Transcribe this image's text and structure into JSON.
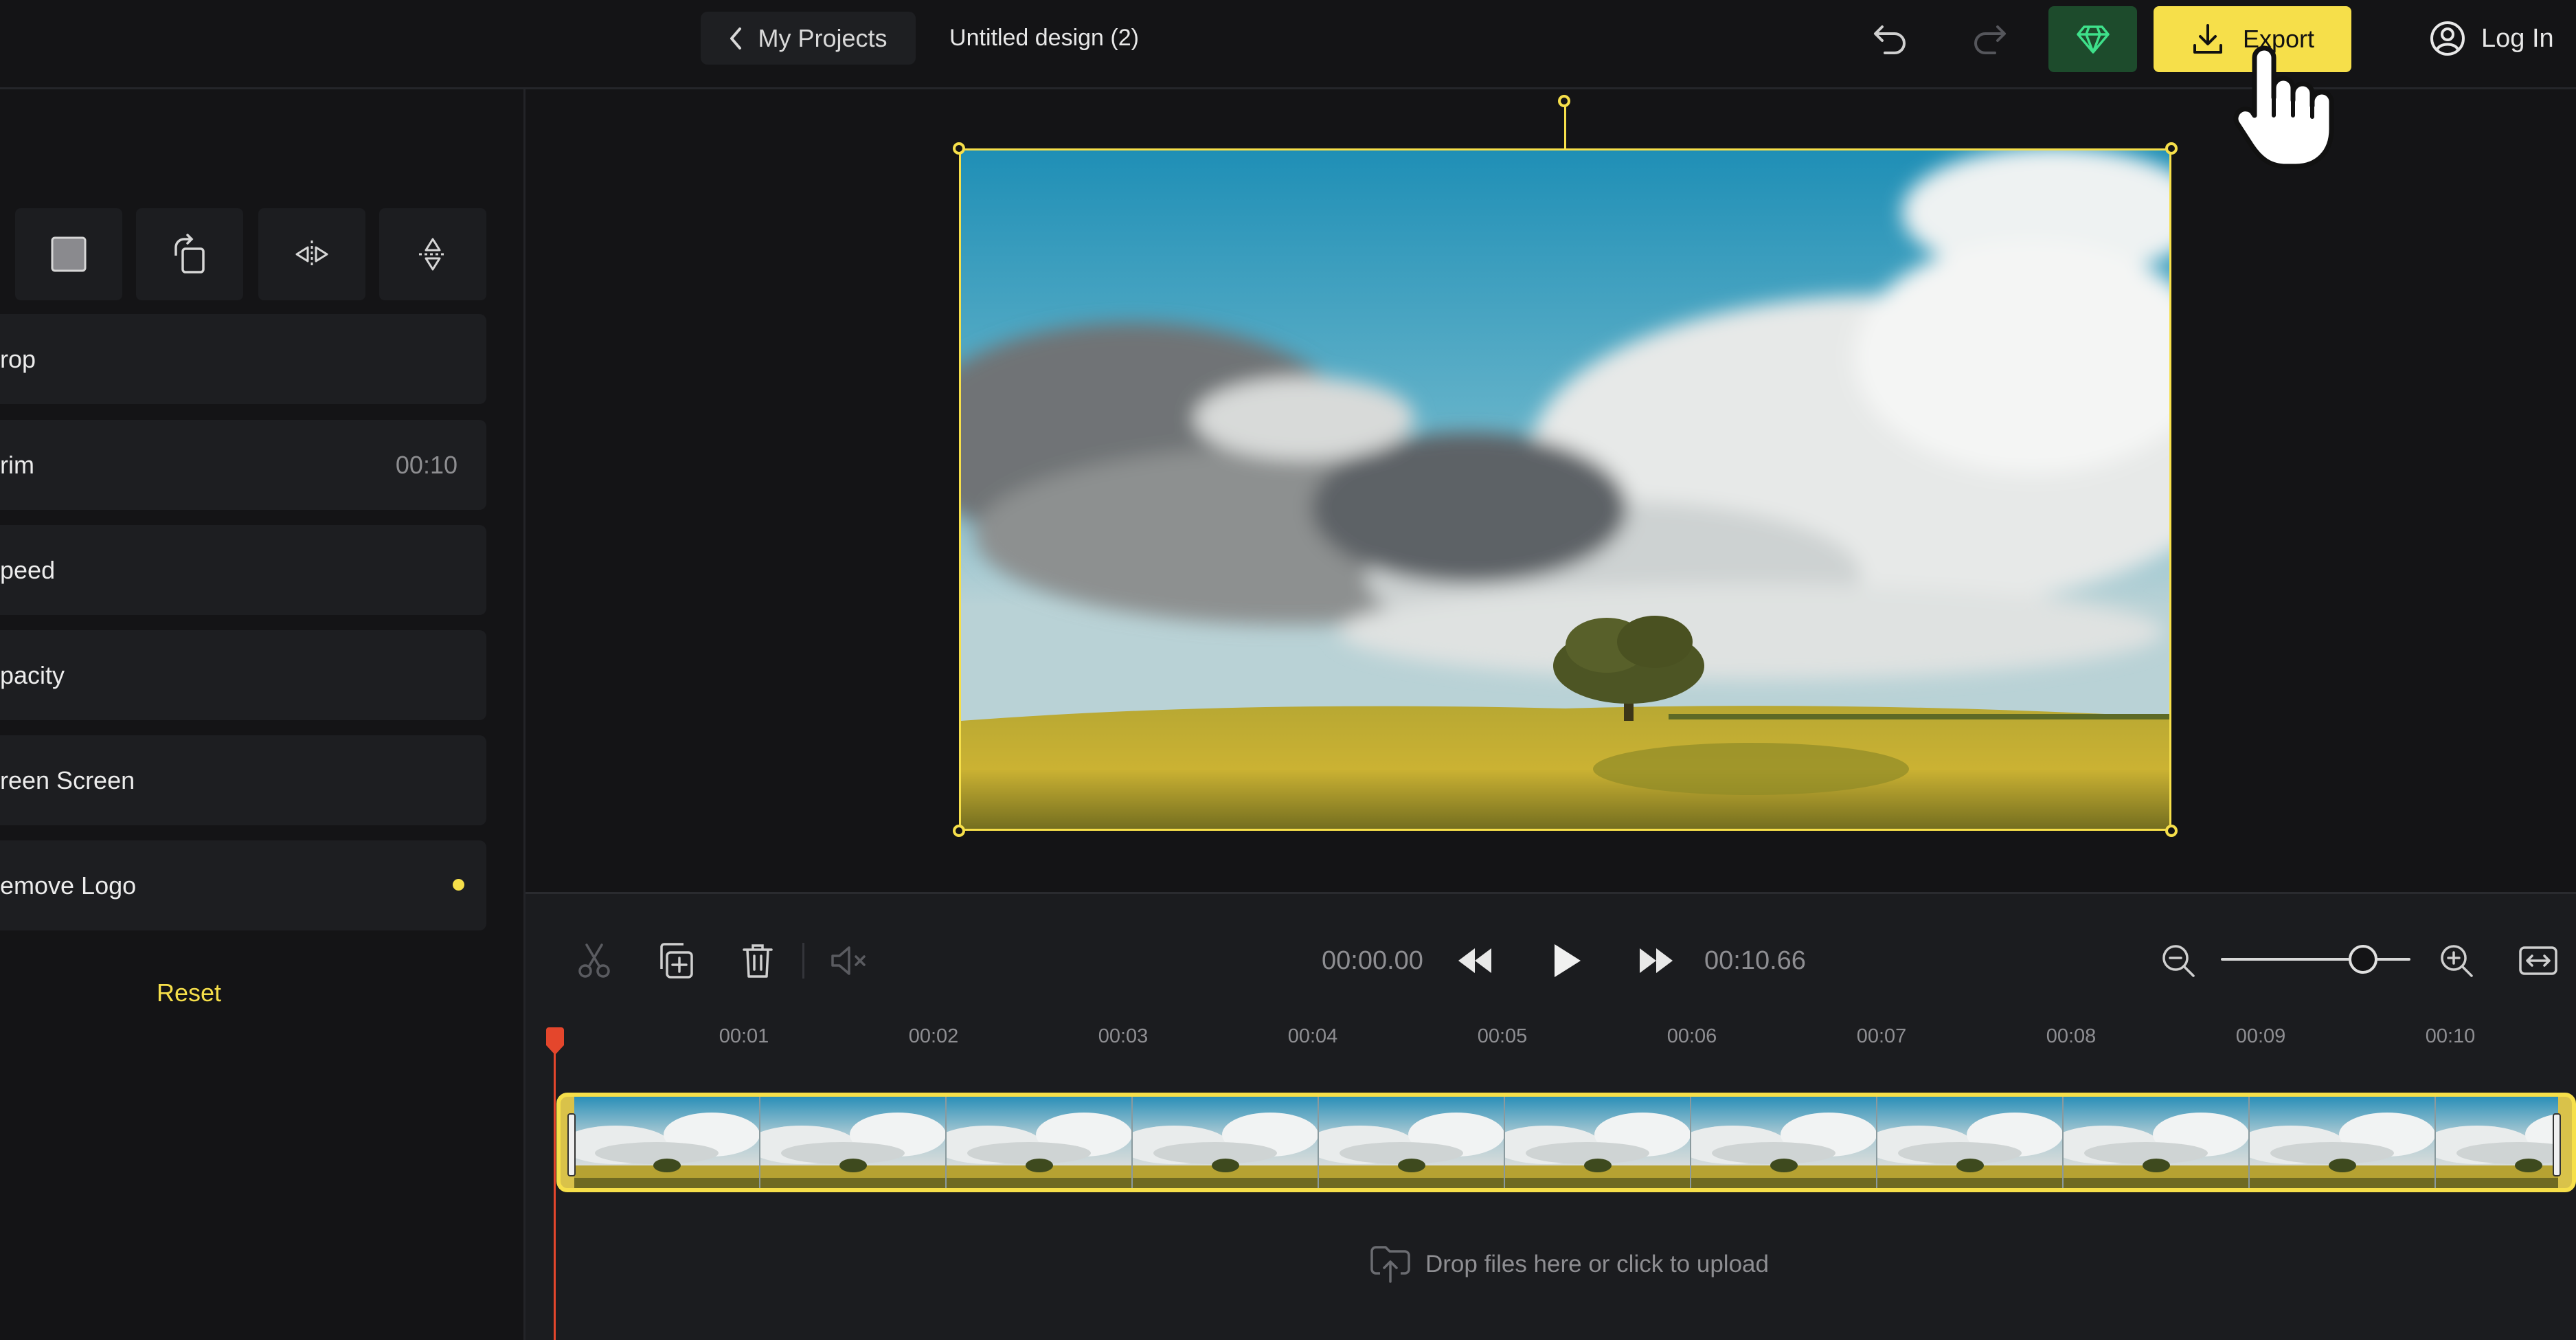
{
  "header": {
    "back_label": "My Projects",
    "design_title": "Untitled design (2)",
    "export_label": "Export",
    "login_label": "Log In"
  },
  "colors": {
    "accent": "#f6df4a",
    "premium": "#1d4b2c",
    "playhead": "#e4462c",
    "background": "#141416"
  },
  "properties": {
    "tools": [
      "square-icon",
      "rotate-icon",
      "flip-horizontal-icon",
      "flip-vertical-icon"
    ],
    "rows": [
      {
        "label": "rop",
        "value": ""
      },
      {
        "label": "rim",
        "value": "00:10"
      },
      {
        "label": "peed",
        "value": ""
      },
      {
        "label": "pacity",
        "value": ""
      },
      {
        "label": "reen Screen",
        "value": ""
      },
      {
        "label": "emove Logo",
        "value": ""
      }
    ],
    "reset_label": "Reset"
  },
  "player": {
    "current_time": "00:00.00",
    "duration": "00:10.66"
  },
  "timeline": {
    "ruler": [
      "00:01",
      "00:02",
      "00:03",
      "00:04",
      "00:05",
      "00:06",
      "00:07",
      "00:08",
      "00:09",
      "00:10"
    ],
    "zoom_level": 0.75,
    "upload_text": "Drop files here or click to upload"
  }
}
